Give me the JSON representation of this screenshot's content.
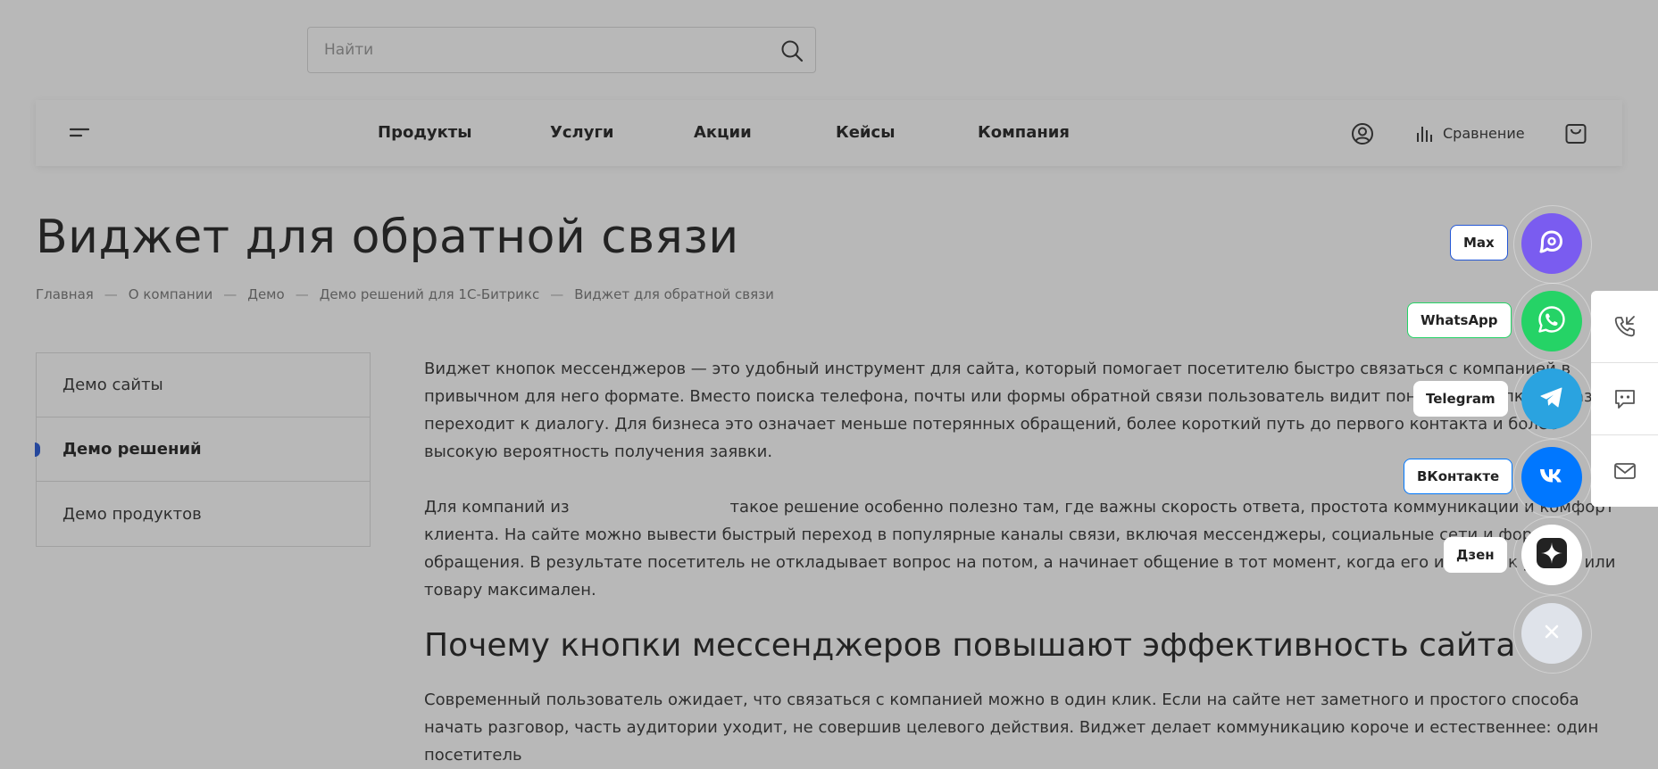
{
  "search": {
    "placeholder": "Найти"
  },
  "nav": {
    "items": [
      "Продукты",
      "Услуги",
      "Акции",
      "Кейсы",
      "Компания"
    ],
    "compare_label": "Сравнение"
  },
  "page_title": "Виджет для обратной связи",
  "breadcrumb": [
    "Главная",
    "О компании",
    "Демо",
    "Демо решений для 1С-Битрикс",
    "Виджет для обратной связи"
  ],
  "breadcrumb_separator": "—",
  "sidebar": {
    "items": [
      {
        "label": "Демо сайты",
        "active": false
      },
      {
        "label": "Демо решений",
        "active": true
      },
      {
        "label": "Демо продуктов",
        "active": false
      }
    ]
  },
  "content": {
    "p1": "Виджет кнопок мессенджеров — это удобный инструмент для сайта, который помогает посетителю быстро связаться с компанией в привычном для него формате. Вместо поиска телефона, почты или формы обратной связи пользователь видит понятные кнопки и сразу переходит к диалогу. Для бизнеса это означает меньше потерянных обращений, более короткий путь до первого контакта и более высокую вероятность получения заявки.",
    "p2_start": "Для компаний из",
    "p2_end": "такое решение особенно полезно там, где важны скорость ответа, простота коммуникации и комфорт клиента. На сайте можно вывести быстрый переход в популярные каналы связи, включая мессенджеры, социальные сети и формы обращения. В результате посетитель не откладывает вопрос на потом, а начинает общение в тот момент, когда его интерес к услуге или товару максимален.",
    "h2": "Почему кнопки мессенджеров повышают эффективность сайта",
    "p3": "Современный пользователь ожидает, что связаться с компанией можно в один клик. Если на сайте нет заметного и простого способа начать разговор, часть аудитории уходит, не совершив целевого действия. Виджет делает коммуникацию короче и естественнее: один посетитель"
  },
  "widget": {
    "items": [
      {
        "label": "Max",
        "icon": "max-icon",
        "color": "#7a5cf0",
        "border": "#2457d6"
      },
      {
        "label": "WhatsApp",
        "icon": "whatsapp-icon",
        "color": "#25d366",
        "border": "#25d366"
      },
      {
        "label": "Telegram",
        "icon": "telegram-icon",
        "color": "#2aa3e0",
        "border": "#ffffff"
      },
      {
        "label": "ВКонтакте",
        "icon": "vk-icon",
        "color": "#0077ff",
        "border": "#0077ff"
      },
      {
        "label": "Дзен",
        "icon": "dzen-icon",
        "color": "#ffffff",
        "border": "#ffffff"
      }
    ],
    "close_icon": "close-icon",
    "close_color": "#dfe3ea"
  },
  "side_panel": {
    "icons": [
      "phone-callback-icon",
      "chat-icon",
      "mail-icon"
    ]
  },
  "colors": {
    "accent": "#2457d6",
    "overlay": "rgba(40,40,40,0.33)"
  }
}
